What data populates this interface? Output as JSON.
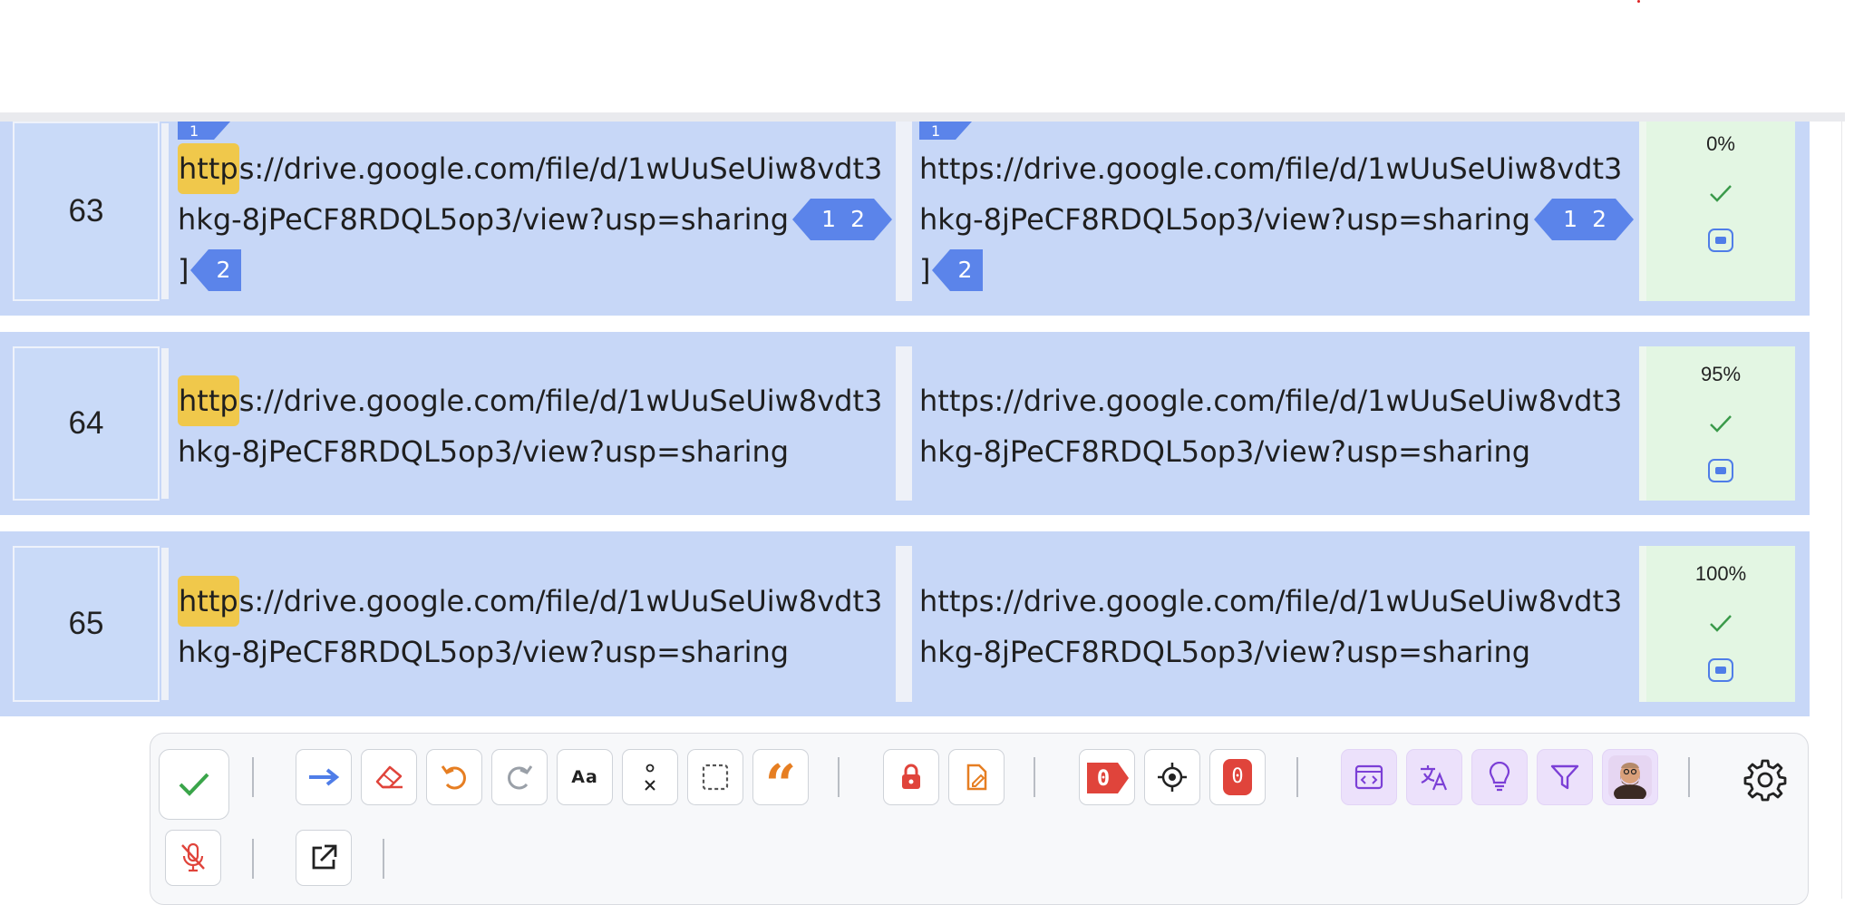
{
  "segments": [
    {
      "number": "63",
      "source": {
        "hl": "http",
        "line1_rest": "s://drive.google.com/file/d/1wUuSeUiw8vdt3",
        "line2": "hkg-8jPeCF8RDQL5op3/view?usp=sharing",
        "line3": "]"
      },
      "target": {
        "line1": "https://drive.google.com/file/d/1wUuSeUiw8vdt3",
        "line2": "hkg-8jPeCF8RDQL5op3/view?usp=sharing",
        "line3": "]"
      },
      "tags": {
        "pair_first": "1",
        "pair_second": "2",
        "single": "2",
        "cut": "1"
      },
      "match": "0%"
    },
    {
      "number": "64",
      "source": {
        "hl": "http",
        "line1_rest": "s://drive.google.com/file/d/1wUuSeUiw8vdt3",
        "line2": "hkg-8jPeCF8RDQL5op3/view?usp=sharing"
      },
      "target": {
        "line1": "https://drive.google.com/file/d/1wUuSeUiw8vdt3",
        "line2": "hkg-8jPeCF8RDQL5op3/view?usp=sharing"
      },
      "match": "95%"
    },
    {
      "number": "65",
      "source": {
        "hl": "http",
        "line1_rest": "s://drive.google.com/file/d/1wUuSeUiw8vdt3",
        "line2": "hkg-8jPeCF8RDQL5op3/view?usp=sharing"
      },
      "target": {
        "line1": "https://drive.google.com/file/d/1wUuSeUiw8vdt3",
        "line2": "hkg-8jPeCF8RDQL5op3/view?usp=sharing"
      },
      "match": "100%"
    }
  ],
  "toolbar": {
    "case_label": "Aa",
    "qa_count": "0",
    "error_count": "0",
    "icons": [
      "confirm-icon",
      "copy-source-arrow-icon",
      "eraser-icon",
      "undo-icon",
      "redo-icon",
      "case-icon",
      "special-chars-icon",
      "select-icon",
      "quote-icon",
      "lock-icon",
      "file-edit-icon",
      "tag-icon",
      "target-icon",
      "error-badge",
      "code-icon",
      "translate-icon",
      "lightbulb-icon",
      "filter-icon",
      "avatar",
      "gear-icon",
      "mic-off-icon",
      "external-link-icon"
    ]
  },
  "colors": {
    "row_bg": "#c7d7f7",
    "tag_blue": "#5b84ea",
    "highlight": "#f0c84b",
    "score_bg": "#e3f6e3",
    "check": "#3a9a4a",
    "danger": "#e0443b",
    "orange": "#e67e22",
    "purple": "#7b3fd6"
  }
}
